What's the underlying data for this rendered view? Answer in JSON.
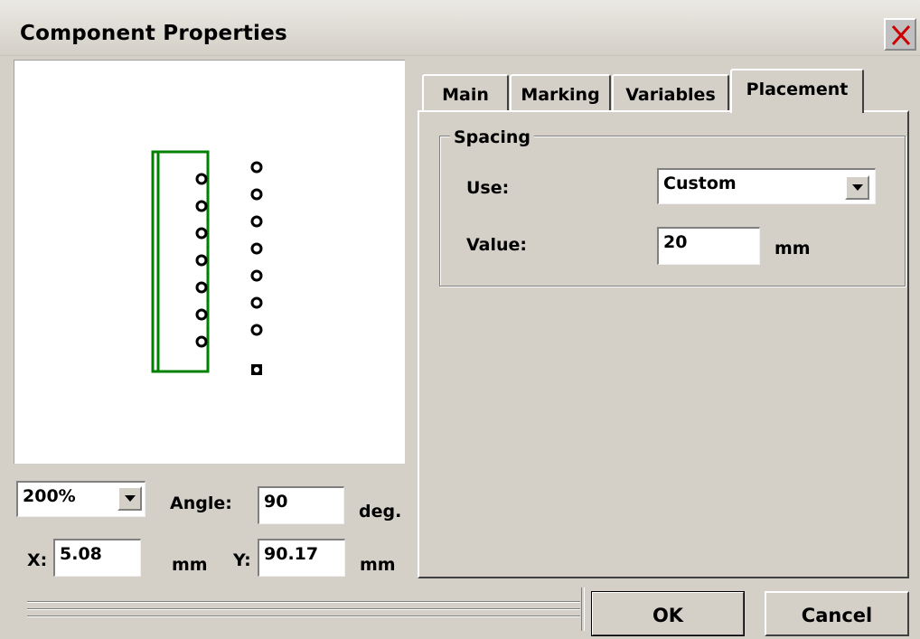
{
  "window": {
    "title": "Component Properties"
  },
  "preview": {
    "zoom": "200%",
    "angle_label": "Angle:",
    "angle_value": "90",
    "angle_unit": "deg.",
    "x_label": "X:",
    "x_value": "5.08",
    "x_unit": "mm",
    "y_label": "Y:",
    "y_value": "90.17",
    "y_unit": "mm"
  },
  "tabs": [
    {
      "label": "Main",
      "active": false
    },
    {
      "label": "Marking",
      "active": false
    },
    {
      "label": "Variables",
      "active": false
    },
    {
      "label": "Placement",
      "active": true
    }
  ],
  "placement": {
    "group_title": "Spacing",
    "use_label": "Use:",
    "use_value": "Custom",
    "value_label": "Value:",
    "value_value": "20",
    "value_unit": "mm"
  },
  "buttons": {
    "ok": "OK",
    "cancel": "Cancel"
  },
  "icons": {
    "close": "close-x-icon",
    "dropdown": "chevron-down-icon"
  },
  "colors": {
    "outline": "#008000",
    "preview_bg": "#ffffff",
    "dialog_bg": "#d4d0c8"
  }
}
